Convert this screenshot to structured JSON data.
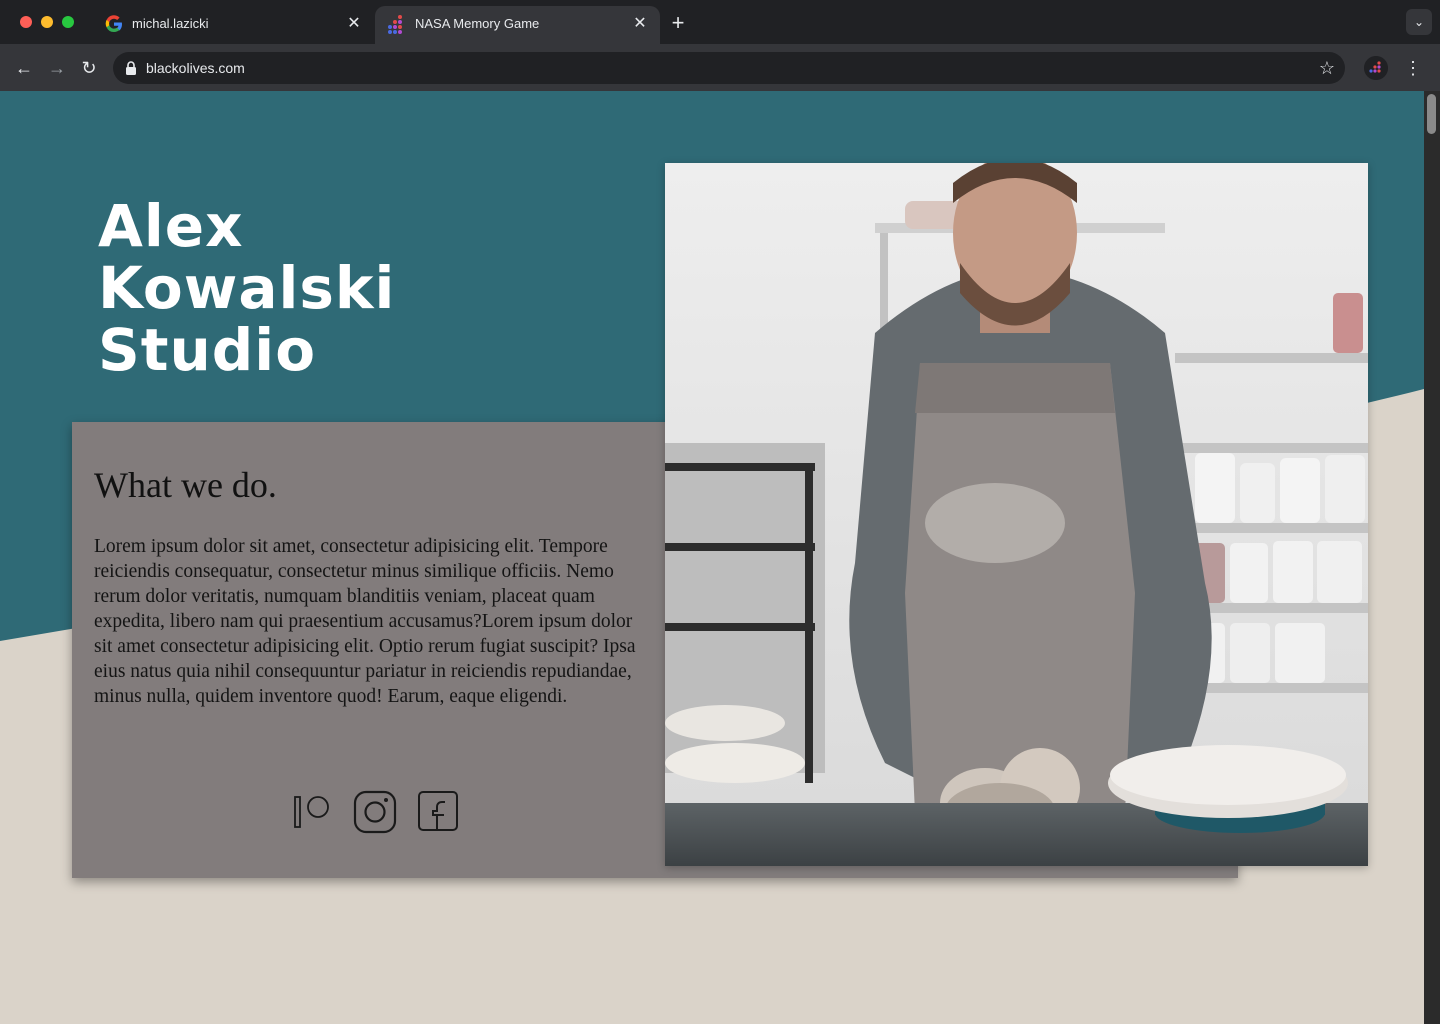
{
  "browser": {
    "tabs": [
      {
        "title": "michal.lazicki",
        "icon": "google-icon"
      },
      {
        "title": "NASA Memory Game",
        "icon": "nasa-dots-icon"
      }
    ],
    "url": "blackolives.com"
  },
  "hero": {
    "title_lines": [
      "Alex",
      "Kowalski",
      "Studio"
    ]
  },
  "about": {
    "heading": "What we do.",
    "body": "Lorem ipsum dolor sit amet, consectetur adipisicing elit. Tempore reiciendis consequatur, consectetur minus similique officiis. Nemo rerum dolor veritatis, numquam blanditiis veniam, placeat quam expedita, libero nam qui praesentium accusamus?Lorem ipsum dolor sit amet consectetur adipisicing elit. Optio rerum fugiat suscipit? Ipsa eius natus quia nihil consequuntur pariatur in reiciendis repudiandae, minus nulla, quidem inventore quod! Earum, eaque eligendi.",
    "social": [
      "patreon-icon",
      "instagram-icon",
      "facebook-icon"
    ]
  },
  "colors": {
    "teal": "#2f6a76",
    "sand": "#dad3c9",
    "card": "#827c7c"
  }
}
